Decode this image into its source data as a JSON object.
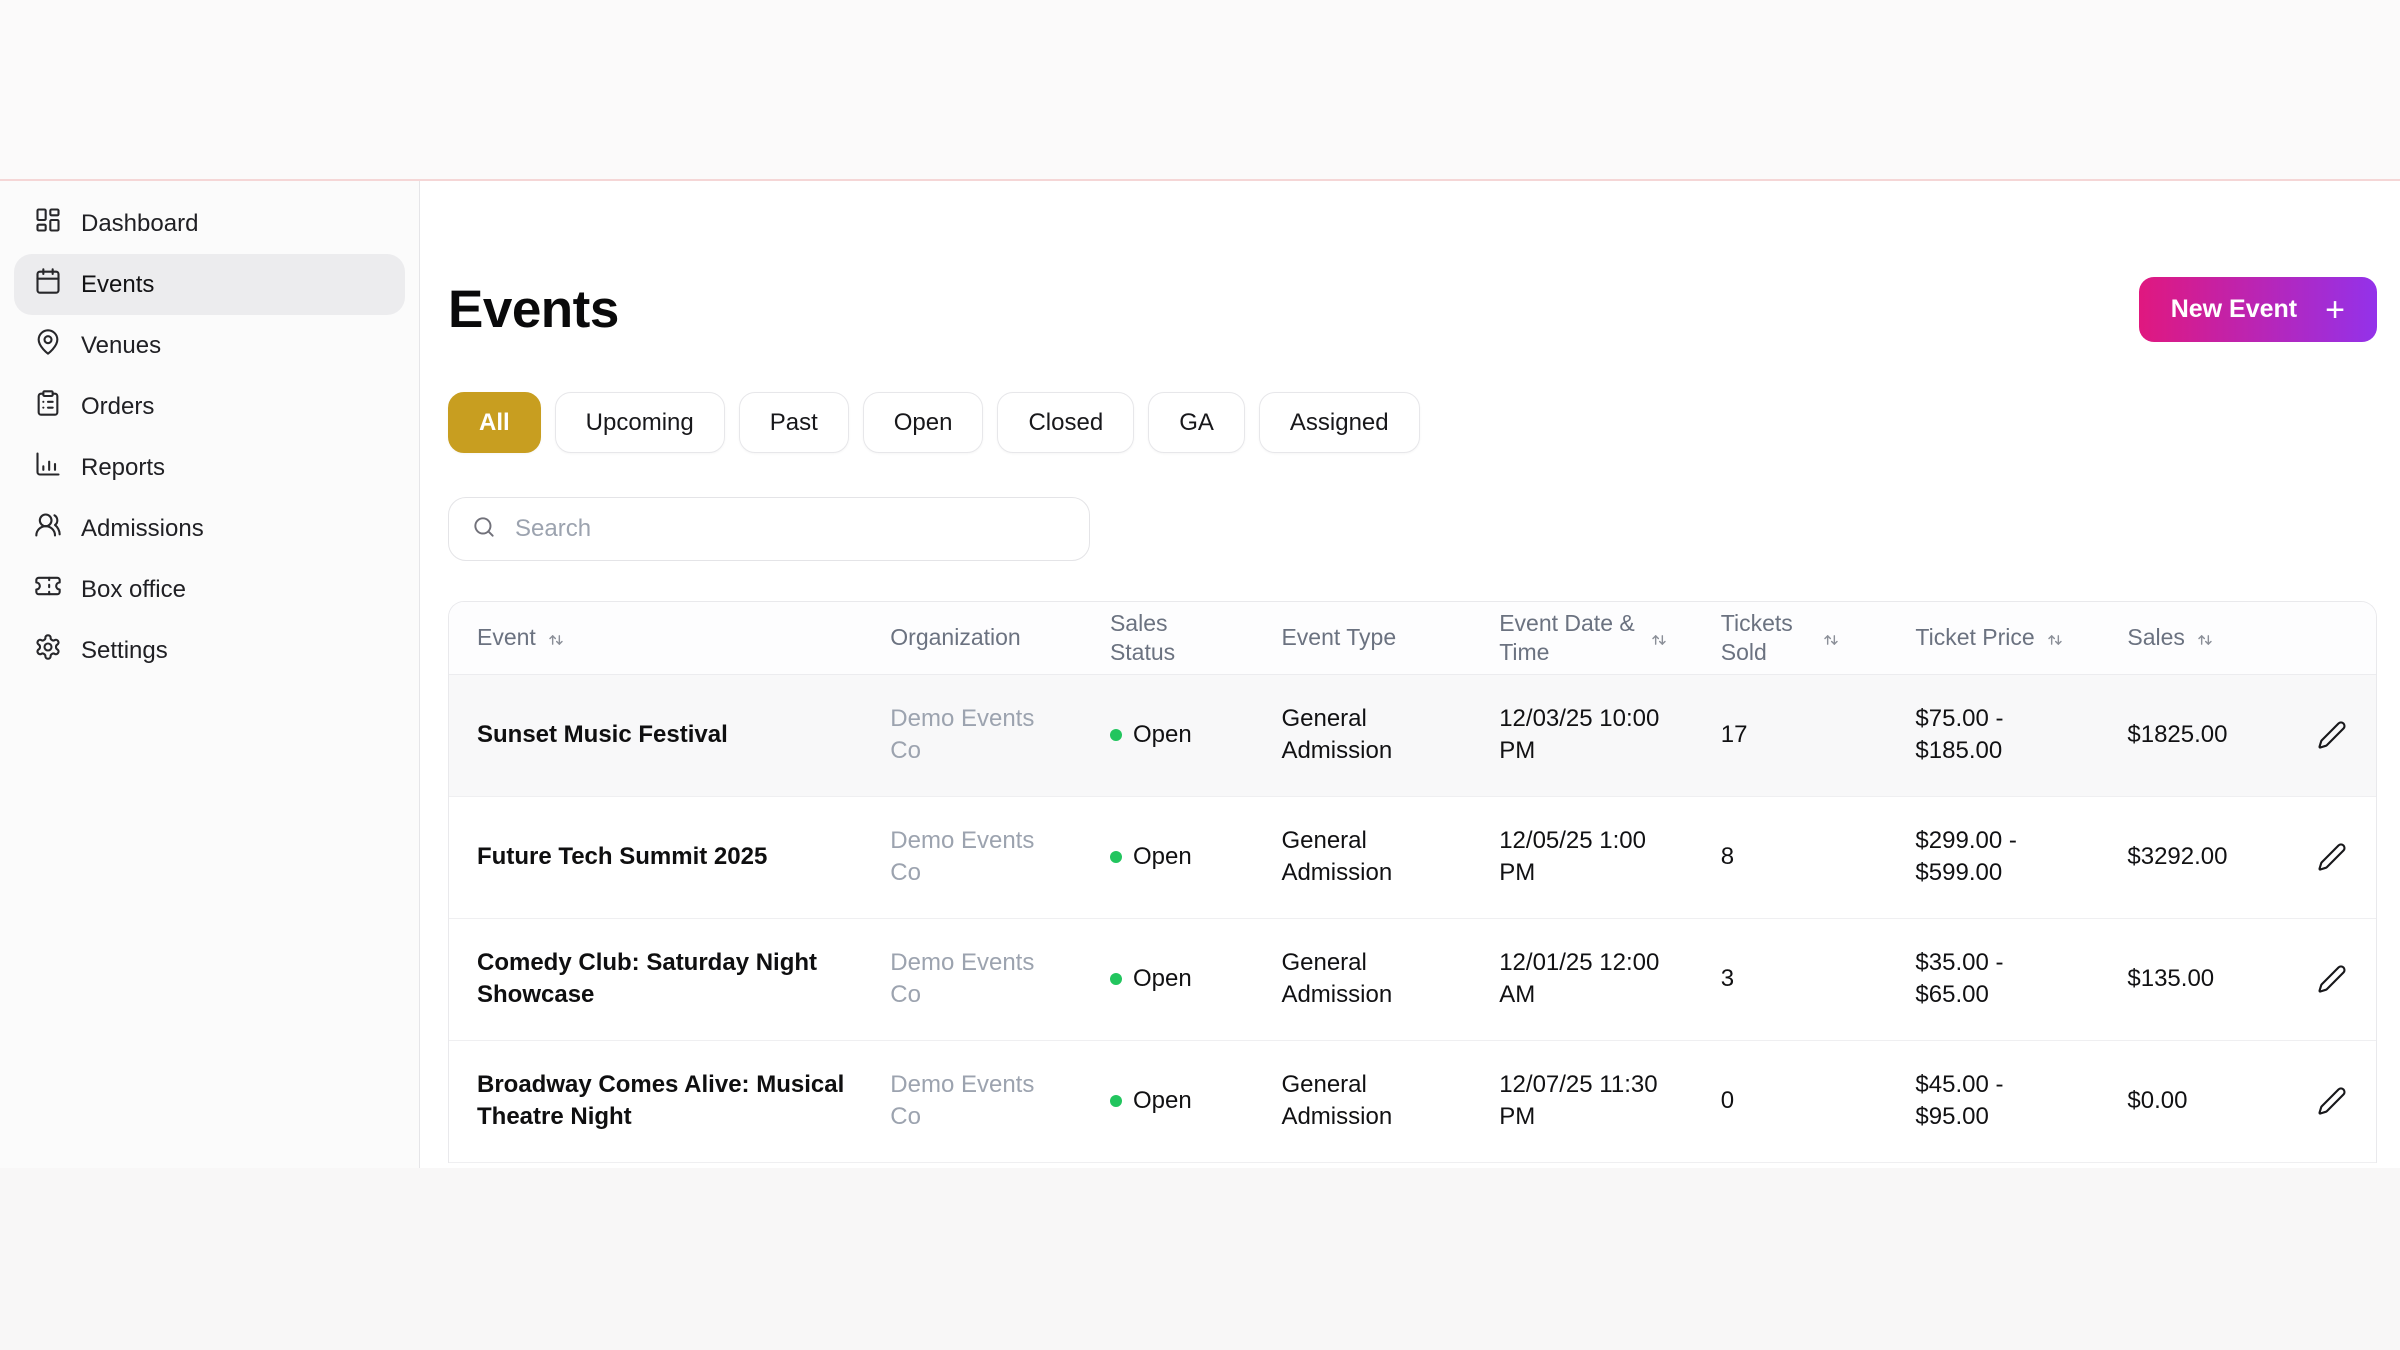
{
  "sidebar": {
    "items": [
      {
        "label": "Dashboard"
      },
      {
        "label": "Events"
      },
      {
        "label": "Venues"
      },
      {
        "label": "Orders"
      },
      {
        "label": "Reports"
      },
      {
        "label": "Admissions"
      },
      {
        "label": "Box office"
      },
      {
        "label": "Settings"
      }
    ]
  },
  "page": {
    "title": "Events"
  },
  "actions": {
    "new_event_label": "New Event",
    "new_event_plus": "+"
  },
  "filters": {
    "all": "All",
    "upcoming": "Upcoming",
    "past": "Past",
    "open": "Open",
    "closed": "Closed",
    "ga": "GA",
    "assigned": "Assigned"
  },
  "search": {
    "placeholder": "Search"
  },
  "table": {
    "headers": {
      "event": "Event",
      "organization": "Organization",
      "sales_status": "Sales Status",
      "event_type": "Event Type",
      "date": "Event Date & Time",
      "tickets": "Tickets Sold",
      "price": "Ticket Price",
      "sales": "Sales"
    },
    "rows": [
      {
        "event": "Sunset Music Festival",
        "organization": "Demo Events Co",
        "status": "Open",
        "type": "General Admission",
        "datetime": "12/03/25 10:00 PM",
        "tickets_sold": "17",
        "ticket_price": "$75.00 - $185.00",
        "sales": "$1825.00"
      },
      {
        "event": "Future Tech Summit 2025",
        "organization": "Demo Events Co",
        "status": "Open",
        "type": "General Admission",
        "datetime": "12/05/25 1:00 PM",
        "tickets_sold": "8",
        "ticket_price": "$299.00 - $599.00",
        "sales": "$3292.00"
      },
      {
        "event": "Comedy Club: Saturday Night Showcase",
        "organization": "Demo Events Co",
        "status": "Open",
        "type": "General Admission",
        "datetime": "12/01/25 12:00 AM",
        "tickets_sold": "3",
        "ticket_price": "$35.00 - $65.00",
        "sales": "$135.00"
      },
      {
        "event": "Broadway Comes Alive: Musical Theatre Night",
        "organization": "Demo Events Co",
        "status": "Open",
        "type": "General Admission",
        "datetime": "12/07/25 11:30 PM",
        "tickets_sold": "0",
        "ticket_price": "$45.00 - $95.00",
        "sales": "$0.00"
      }
    ]
  },
  "colors": {
    "accent_gold": "#c89e20",
    "brand_gradient_start": "#e0187f",
    "brand_gradient_end": "#9332ea",
    "status_open_green": "#22c55e",
    "top_divider_pink": "#f5d6d6"
  }
}
